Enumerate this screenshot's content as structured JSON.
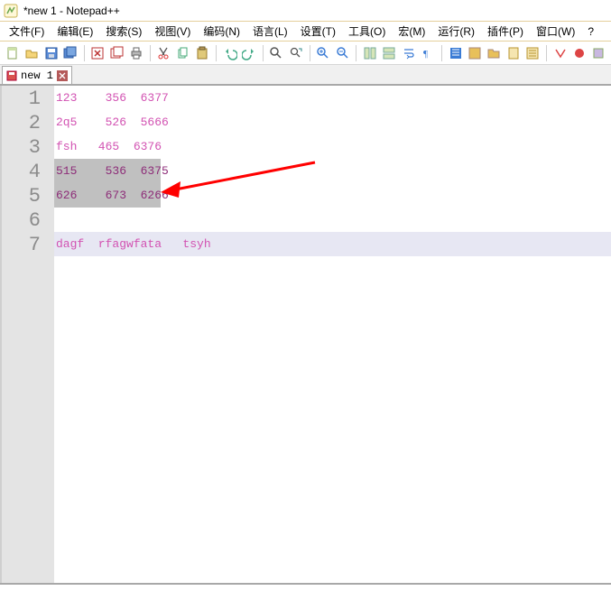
{
  "window": {
    "title": "*new 1 - Notepad++"
  },
  "menu": [
    "文件(F)",
    "编辑(E)",
    "搜索(S)",
    "视图(V)",
    "编码(N)",
    "语言(L)",
    "设置(T)",
    "工具(O)",
    "宏(M)",
    "运行(R)",
    "插件(P)",
    "窗口(W)",
    "?"
  ],
  "tab": {
    "label": "new 1"
  },
  "lines": [
    {
      "n": 1,
      "text": "123    356  6377"
    },
    {
      "n": 2,
      "text": "2q5    526  5666"
    },
    {
      "n": 3,
      "text": "fsh   465  6376"
    },
    {
      "n": 4,
      "text": "515    536  6375",
      "selected": true
    },
    {
      "n": 5,
      "text": "626    673  6266",
      "selected": true
    },
    {
      "n": 6,
      "text": ""
    },
    {
      "n": 7,
      "text": "dagf  rfagwfata   tsyh",
      "current": true
    }
  ],
  "line_height_px": 27,
  "colors": {
    "text_pink": "#d252b2",
    "selected_bg": "#c0c0c0",
    "selected_fg": "#8d2c78",
    "current_line_bg": "#e7e7f3",
    "gutter_bg": "#e4e4e4",
    "gutter_fg": "#8c8c8c",
    "arrow": "#ff0000"
  }
}
